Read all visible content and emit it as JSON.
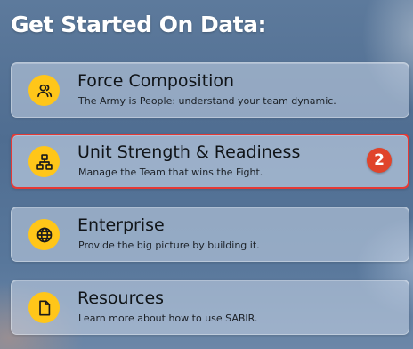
{
  "header": {
    "title": "Get Started On Data:"
  },
  "cards": [
    {
      "title": "Force Composition",
      "description": "The Army is People: understand your team dynamic.",
      "icon": "people-icon"
    },
    {
      "title": "Unit Strength & Readiness",
      "description": "Manage the Team that wins the Fight.",
      "icon": "org-chart-icon",
      "badge": "2",
      "highlighted": true
    },
    {
      "title": "Enterprise",
      "description": "Provide the big picture by building it.",
      "icon": "globe-icon"
    },
    {
      "title": "Resources",
      "description": "Learn more about how to use SABIR.",
      "icon": "document-icon"
    }
  ],
  "colors": {
    "accent_yellow": "#ffc619",
    "highlight_border": "#e53935",
    "badge": "#e0442b"
  }
}
